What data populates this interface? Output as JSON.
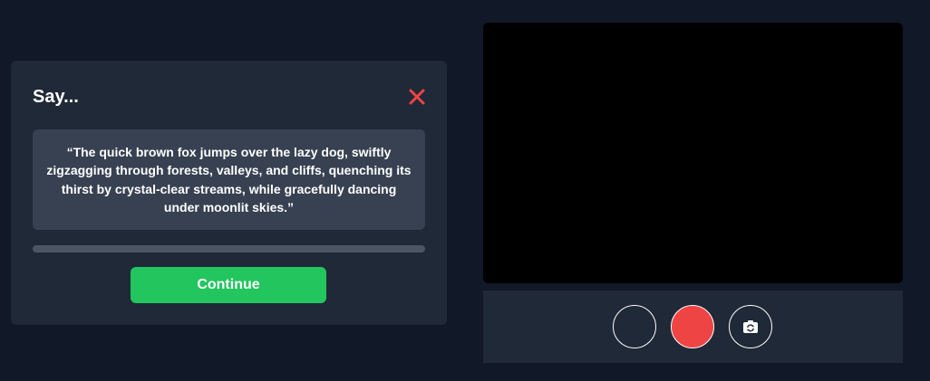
{
  "prompt": {
    "title": "Say...",
    "quote": "“The quick brown fox jumps over the lazy dog, swiftly zigzagging through forests, valleys, and cliffs, quenching its thirst by crystal-clear streams, while gracefully dancing under moonlit skies.”",
    "progress_fraction": 0,
    "continue_label": "Continue",
    "close_icon": "close-x-icon"
  },
  "camera": {
    "controls": [
      {
        "name": "blank-circle-button",
        "icon": "none"
      },
      {
        "name": "record-button",
        "icon": "record-dot"
      },
      {
        "name": "switch-camera-button",
        "icon": "camera-flip-icon"
      }
    ]
  },
  "colors": {
    "page_background": "#111827",
    "card_background": "#1f2937",
    "quote_background": "#374151",
    "progress_track": "#4b5563",
    "accent_green": "#22c55e",
    "close_red": "#ef4444",
    "record_red": "#ef4444",
    "video_background": "#000000"
  }
}
